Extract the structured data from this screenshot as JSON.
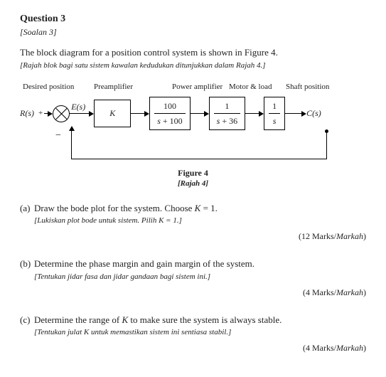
{
  "question": {
    "title": "Question 3",
    "title_sub": "[Soalan 3]",
    "intro": "The block diagram for a position control system is shown in Figure 4.",
    "intro_sub": "[Rajah blok bagi satu sistem kawalan kedudukan ditunjukkan dalam Rajah 4.]"
  },
  "diagram": {
    "labels": {
      "desired": "Desired position",
      "preamp": "Preamplifier",
      "power": "Power amplifier",
      "motor": "Motor & load",
      "shaft": "Shaft position"
    },
    "signals": {
      "input": "R(s)",
      "plus": "+",
      "error": "E(s)",
      "minus": "−",
      "output": "C(s)"
    },
    "blocks": {
      "k": "K",
      "power_num": "100",
      "power_den": "s + 100",
      "motor_num": "1",
      "motor_den": "s + 36",
      "integ_num": "1",
      "integ_den": "s"
    },
    "caption": "Figure 4",
    "caption_sub": "[Rajah 4]"
  },
  "parts": {
    "a": {
      "letter": "(a)",
      "text": "Draw the bode plot for the system. Choose K = 1.",
      "sub": "[Lukiskan plot bode untuk sistem. Pilih K = 1.]",
      "marks": "(12 Marks/",
      "marks_it": "Markah",
      "marks_end": ")"
    },
    "b": {
      "letter": "(b)",
      "text": "Determine the phase margin and gain margin of the system.",
      "sub": "[Tentukan jidar fasa dan jidar gandaan bagi sistem ini.]",
      "marks": "(4 Marks/",
      "marks_it": "Markah",
      "marks_end": ")"
    },
    "c": {
      "letter": "(c)",
      "text": "Determine the range of K to make sure the system is always stable.",
      "sub": "[Tentukan julat K untuk memastikan sistem ini sentiasa stabil.]",
      "marks": "(4 Marks/",
      "marks_it": "Markah",
      "marks_end": ")"
    }
  }
}
